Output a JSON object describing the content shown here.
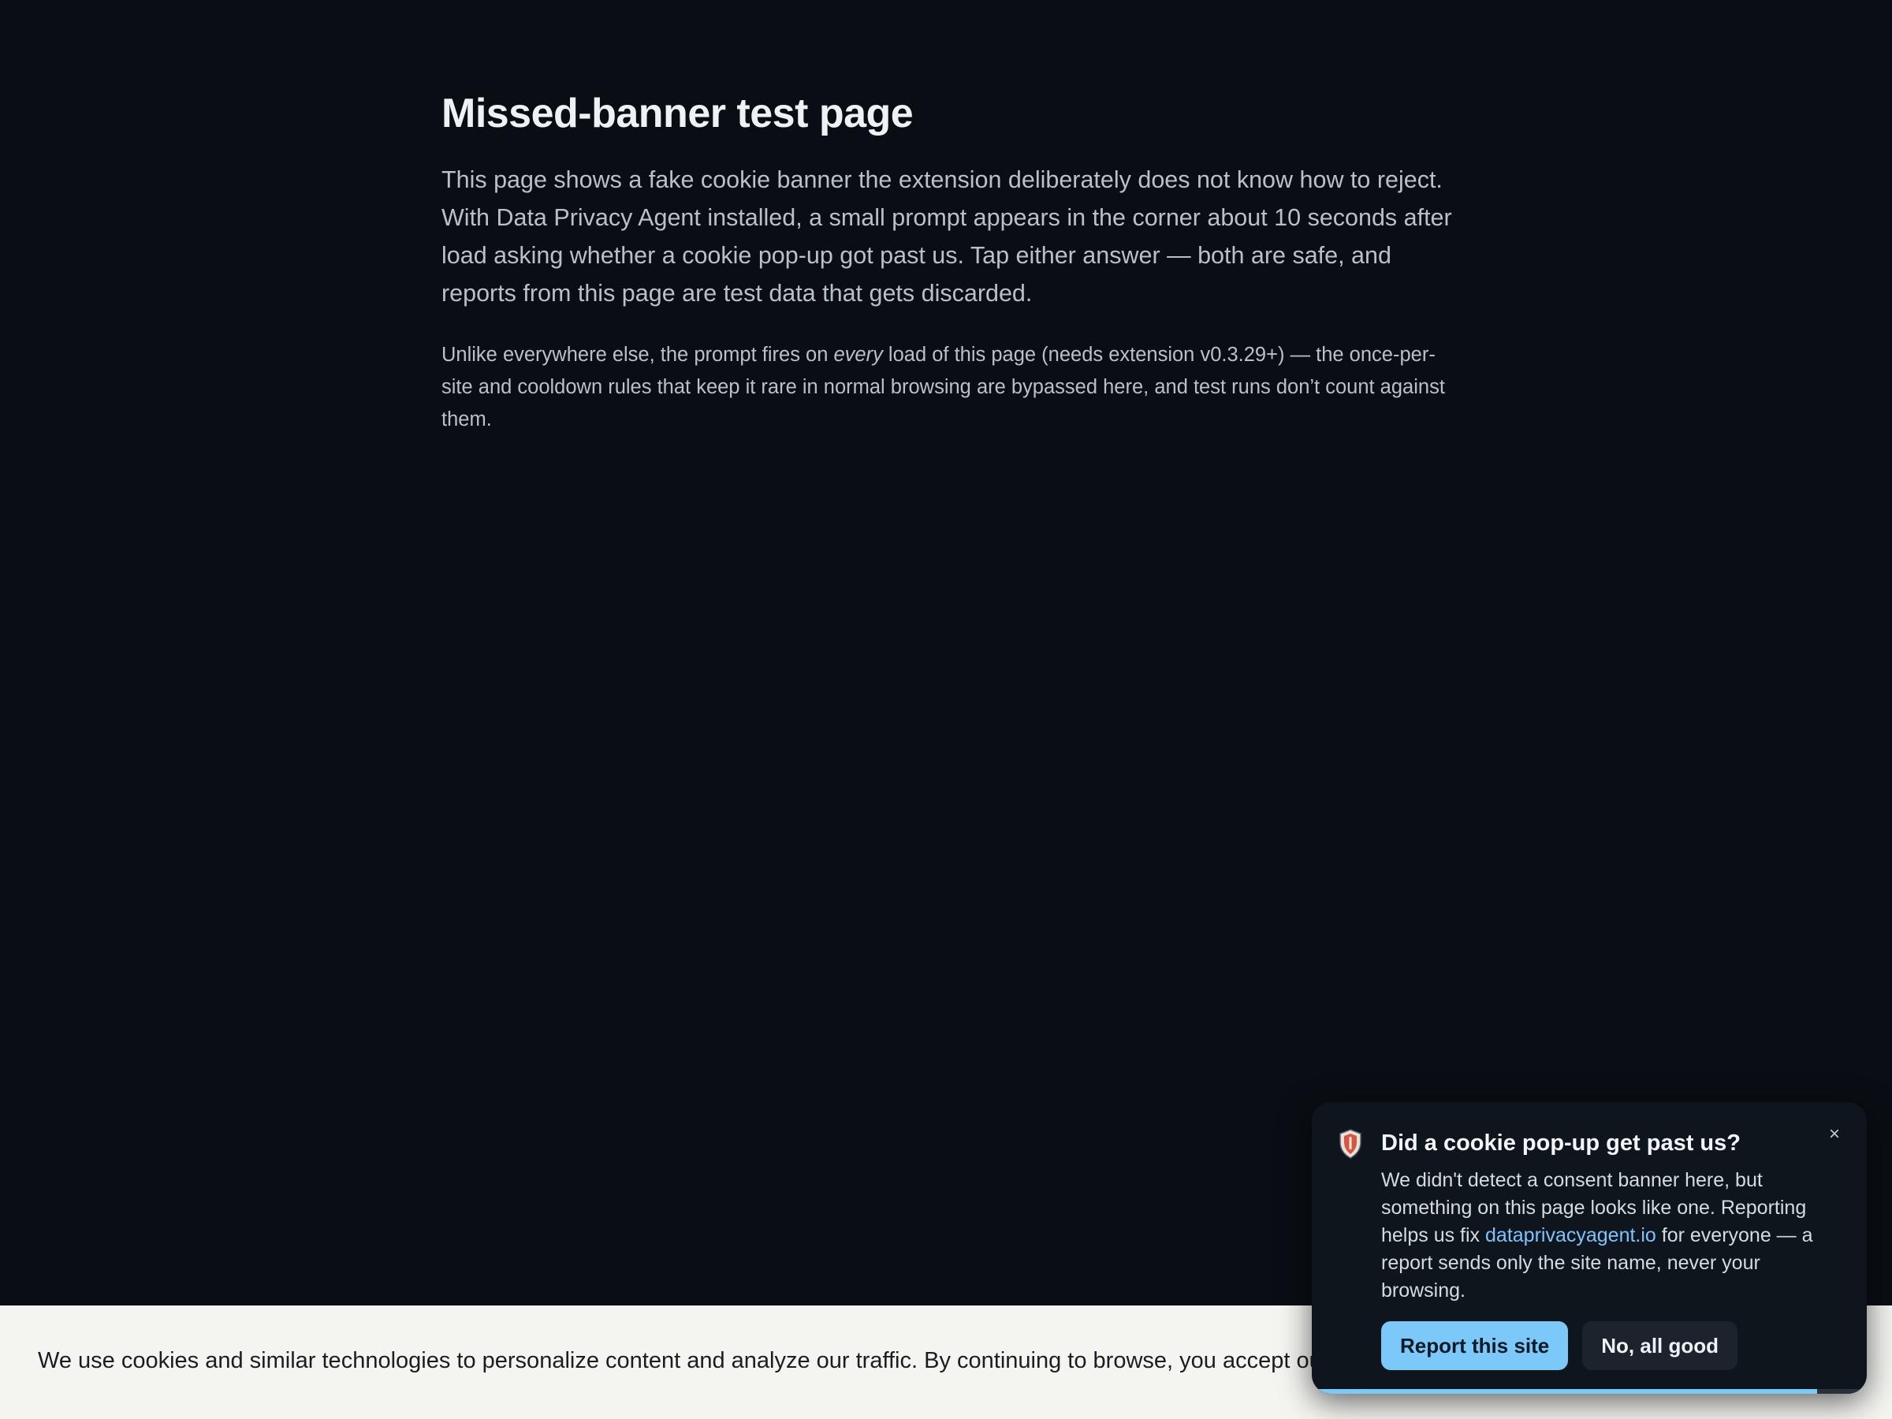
{
  "page": {
    "title": "Missed-banner test page",
    "lead": "This page shows a fake cookie banner the extension deliberately does not know how to reject. With Data Privacy Agent installed, a small prompt appears in the corner about 10 seconds after load asking whether a cookie pop-up got past us. Tap either answer — both are safe, and reports from this page are test data that gets discarded.",
    "note_before": "Unlike everywhere else, the prompt fires on ",
    "note_emphasis": "every",
    "note_after": " load of this page (needs extension v0.3.29+) — the once-per-site and cooldown rules that keep it rare in normal browsing are bypassed here, and test runs don’t count against them."
  },
  "cookie_banner": {
    "text": "We use cookies and similar technologies to personalize content and analyze our traffic. By continuing to browse, you accept our use of cookies."
  },
  "prompt": {
    "icon": "shield-icon",
    "title": "Did a cookie pop-up get past us?",
    "close_label": "×",
    "body_before": "We didn't detect a consent banner here, but something on this page looks like one. Reporting helps us fix ",
    "link_text": "dataprivacyagent.io",
    "body_after": " for everyone — a report sends only the site name, never your browsing.",
    "report_label": "Report this site",
    "dismiss_label": "No, all good",
    "progress_fraction": 0.91
  },
  "colors": {
    "background": "#0a0e14",
    "accent": "#7cc8f8",
    "link": "#7cc4ff",
    "banner_bg": "#f4f5f1"
  }
}
